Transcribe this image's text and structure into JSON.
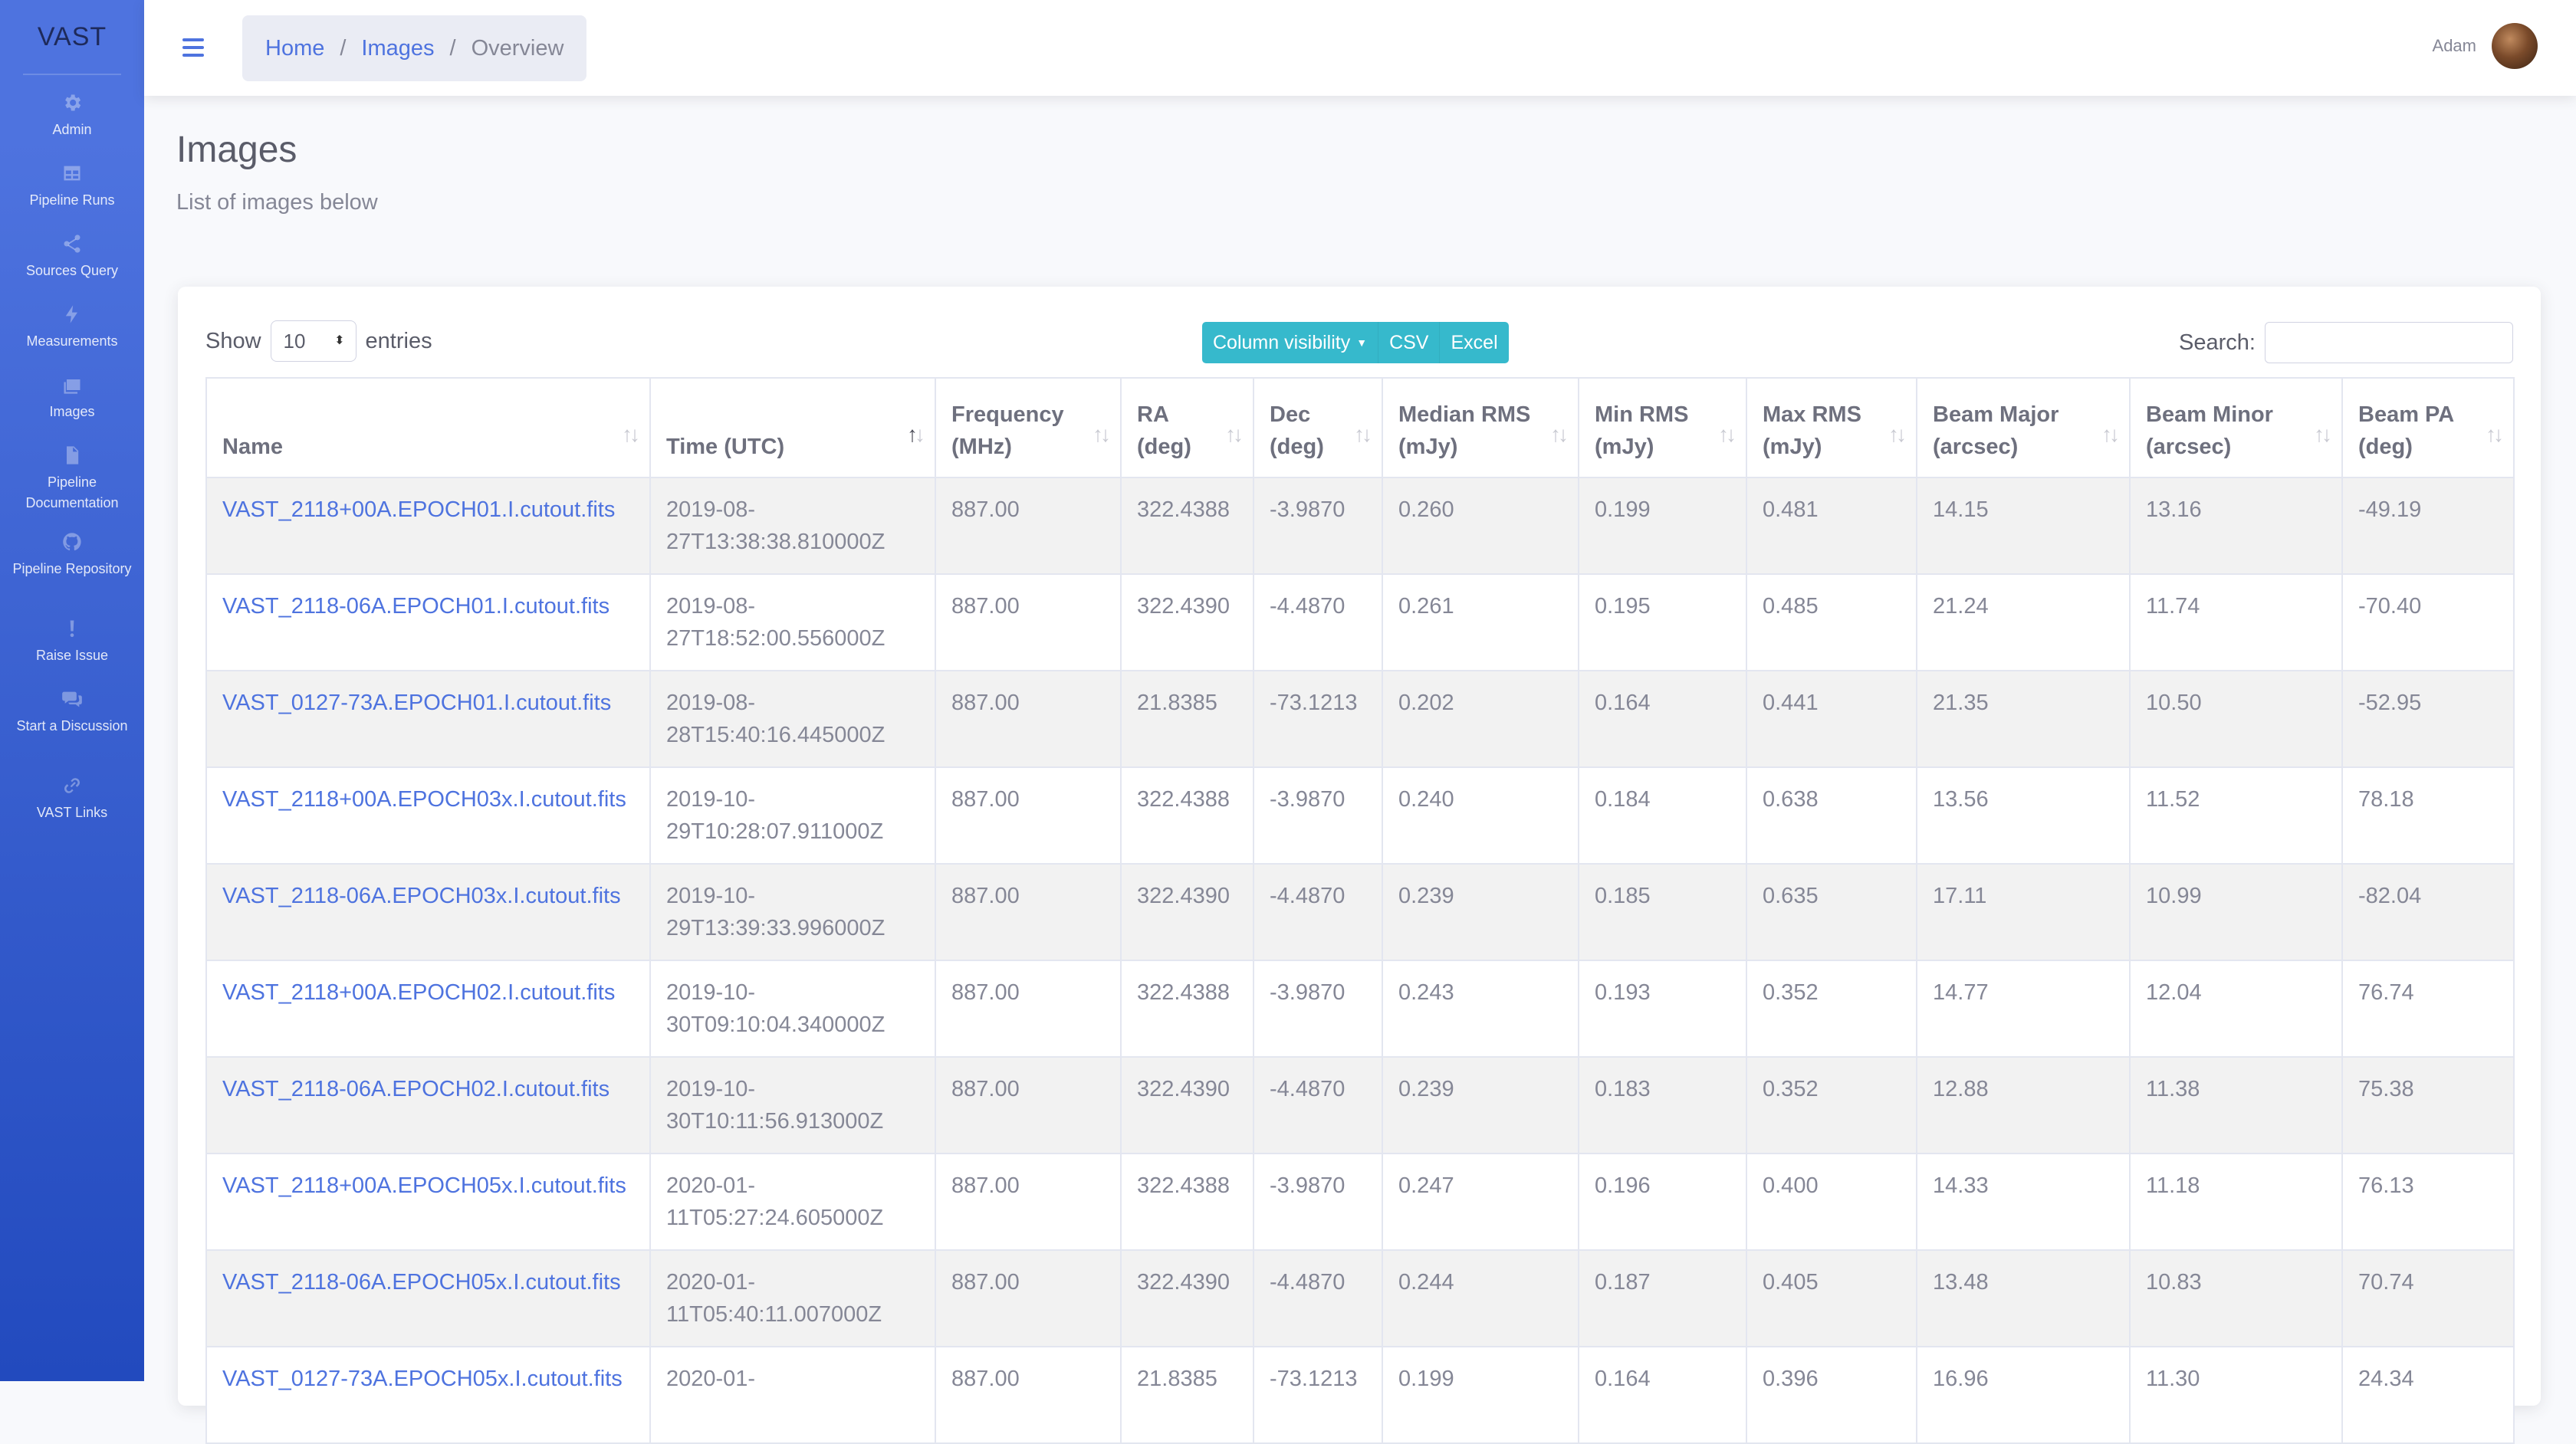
{
  "sidebar": {
    "brand": "VAST",
    "items": [
      {
        "label": "Admin",
        "icon": "gear-icon"
      },
      {
        "label": "Pipeline Runs",
        "icon": "table-icon"
      },
      {
        "label": "Sources Query",
        "icon": "share-icon"
      },
      {
        "label": "Measurements",
        "icon": "bolt-icon"
      },
      {
        "label": "Images",
        "icon": "images-icon"
      },
      {
        "label": "Pipeline Documentation",
        "icon": "document-icon"
      },
      {
        "label": "Pipeline Repository",
        "icon": "github-icon"
      },
      {
        "label": "Raise Issue",
        "icon": "exclamation-icon"
      },
      {
        "label": "Start a Discussion",
        "icon": "comments-icon"
      },
      {
        "label": "VAST Links",
        "icon": "link-icon"
      }
    ]
  },
  "topbar": {
    "breadcrumb": {
      "home": "Home",
      "images": "Images",
      "current": "Overview",
      "separator": "/"
    },
    "user_name": "Adam"
  },
  "page": {
    "title": "Images",
    "subtitle": "List of images below"
  },
  "table_controls": {
    "show_label": "Show",
    "entries_value": "10",
    "entries_label": "entries",
    "column_visibility": "Column visibility",
    "csv": "CSV",
    "excel": "Excel",
    "search_label": "Search:",
    "search_value": ""
  },
  "colors": {
    "sidebar": "#4e73df",
    "link": "#4e73df",
    "button": "#36b9cc"
  },
  "table": {
    "sorted_column": "Time (UTC)",
    "sort_direction": "ascending",
    "columns": [
      {
        "label": "Name"
      },
      {
        "label": "Time (UTC)"
      },
      {
        "label": "Frequency (MHz)"
      },
      {
        "label": "RA (deg)"
      },
      {
        "label": "Dec (deg)"
      },
      {
        "label": "Median RMS (mJy)"
      },
      {
        "label": "Min RMS (mJy)"
      },
      {
        "label": "Max RMS (mJy)"
      },
      {
        "label": "Beam Major (arcsec)"
      },
      {
        "label": "Beam Minor (arcsec)"
      },
      {
        "label": "Beam PA (deg)"
      }
    ],
    "rows": [
      [
        "VAST_2118+00A.EPOCH01.I.cutout.fits",
        "2019-08-27T13:38:38.810000Z",
        "887.00",
        "322.4388",
        "-3.9870",
        "0.260",
        "0.199",
        "0.481",
        "14.15",
        "13.16",
        "-49.19"
      ],
      [
        "VAST_2118-06A.EPOCH01.I.cutout.fits",
        "2019-08-27T18:52:00.556000Z",
        "887.00",
        "322.4390",
        "-4.4870",
        "0.261",
        "0.195",
        "0.485",
        "21.24",
        "11.74",
        "-70.40"
      ],
      [
        "VAST_0127-73A.EPOCH01.I.cutout.fits",
        "2019-08-28T15:40:16.445000Z",
        "887.00",
        "21.8385",
        "-73.1213",
        "0.202",
        "0.164",
        "0.441",
        "21.35",
        "10.50",
        "-52.95"
      ],
      [
        "VAST_2118+00A.EPOCH03x.I.cutout.fits",
        "2019-10-29T10:28:07.911000Z",
        "887.00",
        "322.4388",
        "-3.9870",
        "0.240",
        "0.184",
        "0.638",
        "13.56",
        "11.52",
        "78.18"
      ],
      [
        "VAST_2118-06A.EPOCH03x.I.cutout.fits",
        "2019-10-29T13:39:33.996000Z",
        "887.00",
        "322.4390",
        "-4.4870",
        "0.239",
        "0.185",
        "0.635",
        "17.11",
        "10.99",
        "-82.04"
      ],
      [
        "VAST_2118+00A.EPOCH02.I.cutout.fits",
        "2019-10-30T09:10:04.340000Z",
        "887.00",
        "322.4388",
        "-3.9870",
        "0.243",
        "0.193",
        "0.352",
        "14.77",
        "12.04",
        "76.74"
      ],
      [
        "VAST_2118-06A.EPOCH02.I.cutout.fits",
        "2019-10-30T10:11:56.913000Z",
        "887.00",
        "322.4390",
        "-4.4870",
        "0.239",
        "0.183",
        "0.352",
        "12.88",
        "11.38",
        "75.38"
      ],
      [
        "VAST_2118+00A.EPOCH05x.I.cutout.fits",
        "2020-01-11T05:27:24.605000Z",
        "887.00",
        "322.4388",
        "-3.9870",
        "0.247",
        "0.196",
        "0.400",
        "14.33",
        "11.18",
        "76.13"
      ],
      [
        "VAST_2118-06A.EPOCH05x.I.cutout.fits",
        "2020-01-11T05:40:11.007000Z",
        "887.00",
        "322.4390",
        "-4.4870",
        "0.244",
        "0.187",
        "0.405",
        "13.48",
        "10.83",
        "70.74"
      ],
      [
        "VAST_0127-73A.EPOCH05x.I.cutout.fits",
        "2020-01-",
        "887.00",
        "21.8385",
        "-73.1213",
        "0.199",
        "0.164",
        "0.396",
        "16.96",
        "11.30",
        "24.34"
      ]
    ]
  }
}
